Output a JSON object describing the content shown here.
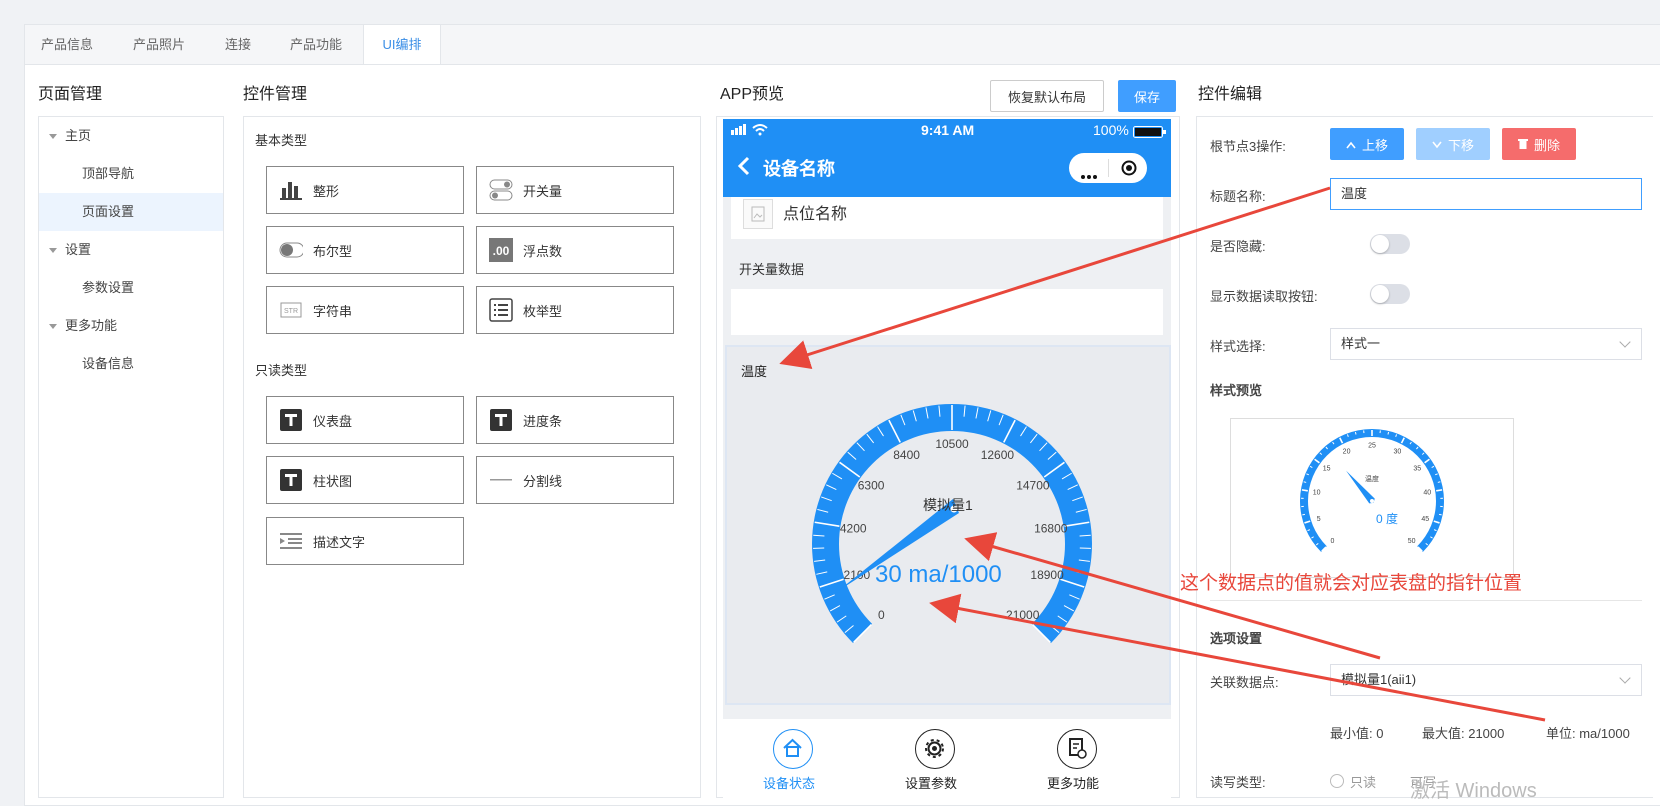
{
  "tabs": [
    "产品信息",
    "产品照片",
    "连接",
    "产品功能",
    "UI编排"
  ],
  "page_mgmt": {
    "title": "页面管理",
    "tree": [
      {
        "label": "主页",
        "level": 0
      },
      {
        "label": "顶部导航",
        "level": 1
      },
      {
        "label": "页面设置",
        "level": 1,
        "selected": true
      },
      {
        "label": "设置",
        "level": 0
      },
      {
        "label": "参数设置",
        "level": 1
      },
      {
        "label": "更多功能",
        "level": 0
      },
      {
        "label": "设备信息",
        "level": 1
      }
    ]
  },
  "ctrl_mgmt": {
    "title": "控件管理",
    "basic_label": "基本类型",
    "basic": [
      {
        "label": "整形",
        "icon": "bar-chart-icon"
      },
      {
        "label": "开关量",
        "icon": "switch-icon"
      },
      {
        "label": "布尔型",
        "icon": "toggle-icon"
      },
      {
        "label": "浮点数",
        "icon": "decimal-icon"
      },
      {
        "label": "字符串",
        "icon": "string-icon"
      },
      {
        "label": "枚举型",
        "icon": "list-icon"
      }
    ],
    "readonly_label": "只读类型",
    "readonly": [
      {
        "label": "仪表盘",
        "icon": "text-t-icon"
      },
      {
        "label": "进度条",
        "icon": "text-t-icon"
      },
      {
        "label": "柱状图",
        "icon": "text-t-icon"
      },
      {
        "label": "分割线",
        "icon": "divider-icon"
      },
      {
        "label": "描述文字",
        "icon": "indent-text-icon"
      }
    ]
  },
  "preview": {
    "title": "APP预览",
    "reset_button": "恢复默认布局",
    "save_button": "保存",
    "phone": {
      "time": "9:41 AM",
      "battery": "100%",
      "nav_title": "设备名称",
      "point_name": "点位名称",
      "switch_section": "开关量数据",
      "gauge_card_title": "温度",
      "gauge_name": "模拟量1",
      "gauge_value_text": "30 ma/1000",
      "gauge_ticks": [
        "0",
        "2100",
        "4200",
        "6300",
        "8400",
        "10500",
        "12600",
        "14700",
        "16800",
        "18900",
        "21000"
      ],
      "bottom_tabs": [
        "设备状态",
        "设置参数",
        "更多功能"
      ]
    }
  },
  "editor": {
    "title": "控件编辑",
    "op_label": "根节点3操作:",
    "up_button": "上移",
    "down_button": "下移",
    "delete_button": "删除",
    "title_name_label": "标题名称:",
    "title_name_value": "温度",
    "hidden_label": "是否隐藏:",
    "read_btn_label": "显示数据读取按钮:",
    "style_label": "样式选择:",
    "style_value": "样式一",
    "style_preview_label": "样式预览",
    "mini_gauge": {
      "title": "温度",
      "value_text": "0 度",
      "ticks": [
        "0",
        "5",
        "10",
        "15",
        "20",
        "25",
        "30",
        "35",
        "40",
        "45",
        "50"
      ]
    },
    "options_label": "选项设置",
    "datapoint_label": "关联数据点:",
    "datapoint_value": "模拟量1(aii1)",
    "min_text": "最小值: 0",
    "max_text": "最大值: 21000",
    "unit_text": "单位: ma/1000",
    "rw_label": "读写类型:",
    "rw_options": [
      "只读",
      "可写"
    ]
  },
  "annotation": "这个数据点的值就会对应表盘的指针位置",
  "watermark": "激活 Windows",
  "colors": {
    "accent": "#3a8ee6",
    "primary_button": "#409eff",
    "danger": "#f56c6c",
    "phone_blue": "#1f8ff5",
    "gauge_blue": "#1f8ff5",
    "annotation_red": "#e8473b"
  }
}
